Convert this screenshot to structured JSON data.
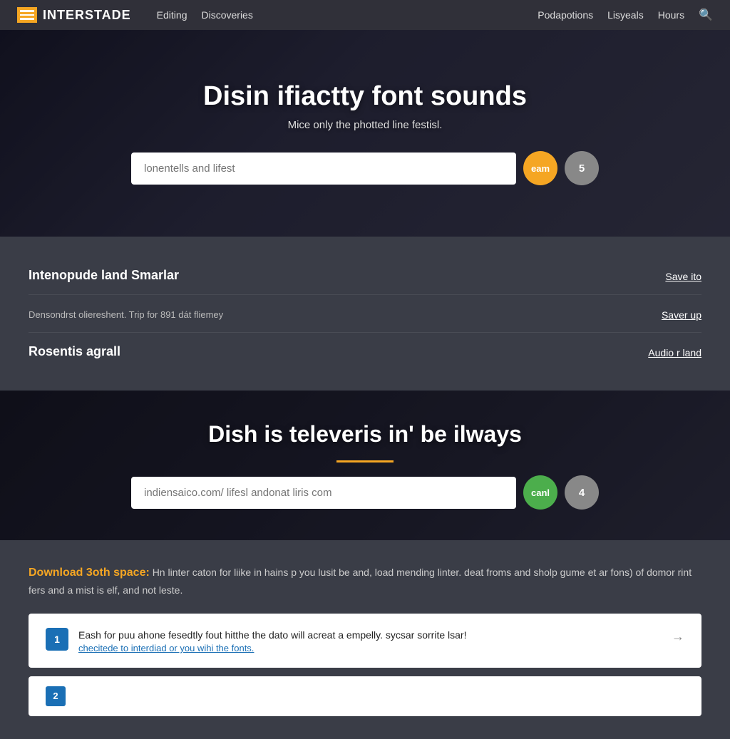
{
  "nav": {
    "logo_text": "INTERSTADE",
    "links_left": [
      "Editing",
      "Discoveries"
    ],
    "links_right": [
      "Podapotions",
      "Lisyeals",
      "Hours"
    ],
    "search_icon": "🔍"
  },
  "hero": {
    "title": "Disin ifiactty font sounds",
    "subtitle": "Mice only the photted line festisl.",
    "input_placeholder": "lonentells and lifest",
    "btn1_label": "eam",
    "btn2_label": "5"
  },
  "info_strip": {
    "rows": [
      {
        "title": "Intenopude land Smarlar",
        "body": "",
        "link": "Save ito"
      },
      {
        "title": "",
        "body": "Densondrst oliereshent. Trip for 891 dát fliemey",
        "link": "Saver up"
      },
      {
        "title": "Rosentis agrall",
        "body": "",
        "link": "Audio r land"
      }
    ]
  },
  "hero2": {
    "title": "Dish is televeris in' be ilways",
    "input_placeholder": "indiensaico.com/ lifesl andonat liris com",
    "btn1_label": "canl",
    "btn2_label": "4"
  },
  "download": {
    "highlight": "Download 3oth space:",
    "body": "Hn linter caton for liike in hains p you lusit be and, load mending linter. deat froms and sholp gume et ar fons) of domor rint fers and a mist is elf, and not leste.",
    "cards": [
      {
        "num": "1",
        "main_text": "Eash for puu ahone fesedtly fout hitthe the dato will acreat a empelly. sycsar sorrite lsar!",
        "link_text": "checitede to interdiad or you wihi the fonts.",
        "has_arrow": true
      },
      {
        "num": "2",
        "main_text": "",
        "link_text": "",
        "has_arrow": false
      }
    ]
  }
}
